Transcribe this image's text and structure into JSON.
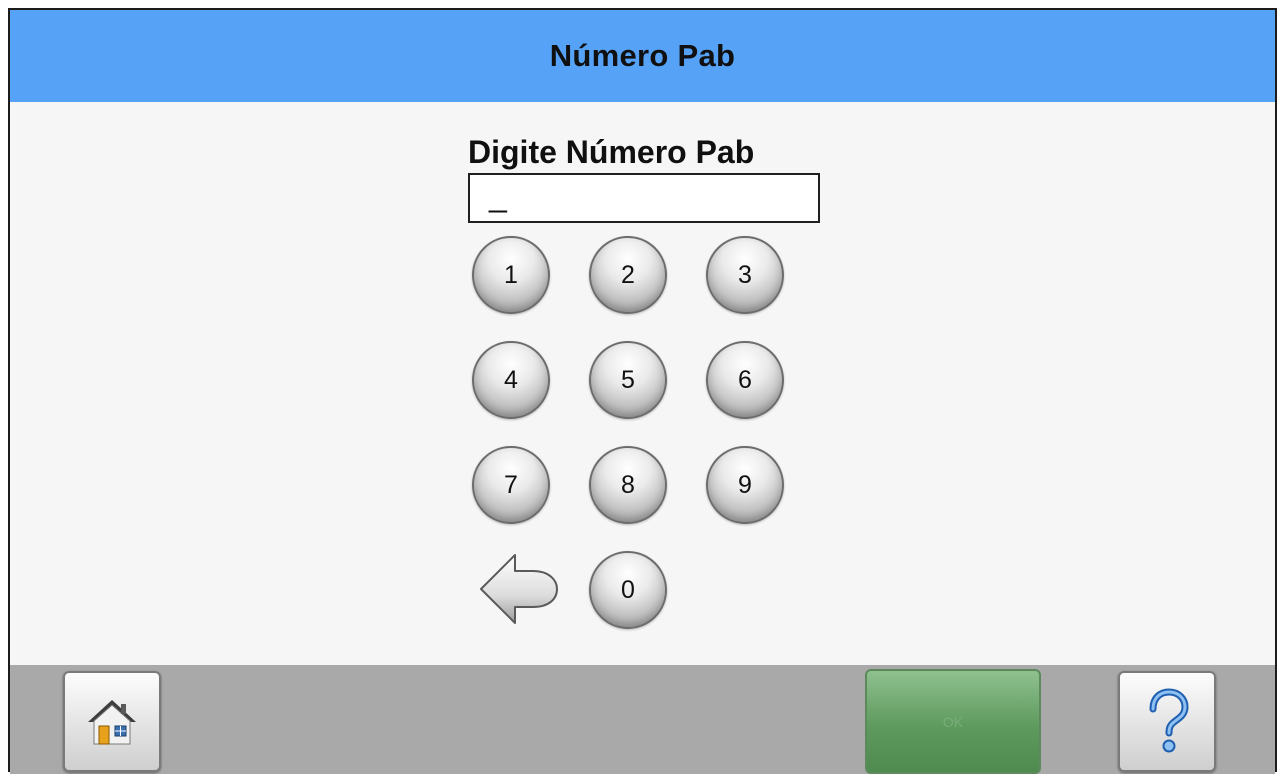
{
  "header": {
    "title": "Número Pab"
  },
  "prompt": {
    "label": "Digite Número Pab"
  },
  "entry": {
    "value": "_"
  },
  "keypad": {
    "keys": [
      "1",
      "2",
      "3",
      "4",
      "5",
      "6",
      "7",
      "8",
      "9",
      "0"
    ]
  },
  "footer": {
    "ok_label": "OK"
  },
  "icons": {
    "home": "home-icon",
    "help": "question-mark-icon",
    "backspace": "back-arrow-icon"
  },
  "colors": {
    "header_bg": "#55a2f6",
    "footer_bg": "#a9a9a9",
    "ok_button": "#5e9a5e"
  }
}
